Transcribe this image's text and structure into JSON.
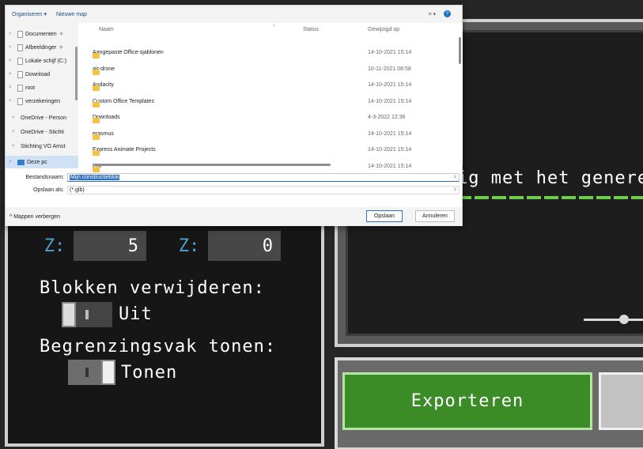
{
  "dialog": {
    "toolbar": {
      "organize": "Organiseren ▾",
      "new_folder": "Nieuwe map"
    },
    "nav": [
      {
        "label": "Documenten",
        "pin": "✈"
      },
      {
        "label": "Afbeeldinger",
        "pin": "✈"
      },
      {
        "label": "Lokale schijf (C:)"
      },
      {
        "label": "Download"
      },
      {
        "label": "root"
      },
      {
        "label": "verzekeringen"
      },
      {
        "label": "OneDrive - Person"
      },
      {
        "label": "OneDrive - Stichti"
      },
      {
        "label": "Stichting VO Amst"
      },
      {
        "label": "Deze pc"
      }
    ],
    "columns": {
      "name": "Naam",
      "status": "Status",
      "modified": "Gewijzigd op"
    },
    "files": [
      {
        "name": "Aangepaste Office-sjablonen",
        "modified": "14-10-2021 15:14"
      },
      {
        "name": "air-drone",
        "modified": "10-11-2021 08:58"
      },
      {
        "name": "Audacity",
        "modified": "14-10-2021 15:14"
      },
      {
        "name": "Custom Office Templates",
        "modified": "14-10-2021 15:14"
      },
      {
        "name": "Downloads",
        "modified": "4-3-2022 12:36"
      },
      {
        "name": "erasmus",
        "modified": "14-10-2021 15:14"
      },
      {
        "name": "Express Animate Projects",
        "modified": "14-10-2021 15:14"
      },
      {
        "name": "Fax",
        "modified": "14-10-2021 15:14"
      }
    ],
    "filename_label": "Bestandsnaam:",
    "filename_value": "Mijn constructieblok",
    "savetype_label": "Opslaan als:",
    "savetype_value": "(*.glb)",
    "hide_folders": "^ Mappen verbergen",
    "save_button": "Opslaan",
    "cancel_button": "Annuleren"
  },
  "game": {
    "generating_text": "ig met het generer",
    "coord_z1_label": "Z:",
    "coord_z1_value": "5",
    "coord_z2_label": "Z:",
    "coord_z2_value": "0",
    "remove_blocks_label": "Blokken verwijderen:",
    "remove_blocks_state": "Uit",
    "bounding_box_label": "Begrenzingsvak tonen:",
    "bounding_box_state": "Tonen",
    "export_button": "Exporteren"
  },
  "colors": {
    "accent_blue": "#2f6fbe",
    "folder_yellow": "#f6c244",
    "mc_green": "#3b8c26",
    "mc_coord_blue": "#4fa3d1"
  }
}
